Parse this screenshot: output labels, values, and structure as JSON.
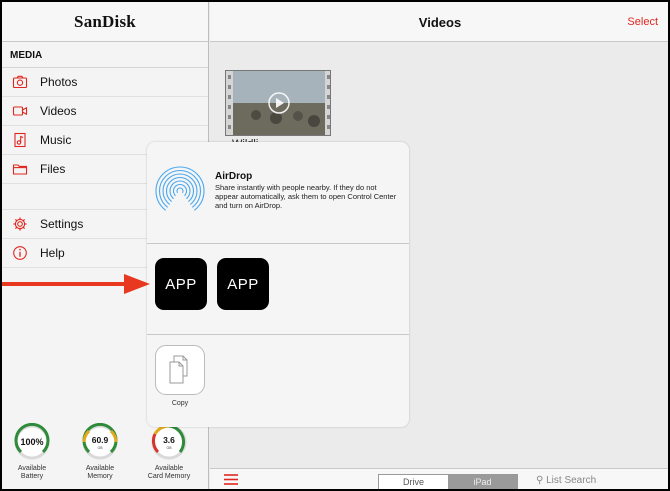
{
  "sidebar": {
    "logo": "SanDisk",
    "section_label": "MEDIA",
    "items": [
      {
        "label": "Photos"
      },
      {
        "label": "Videos"
      },
      {
        "label": "Music"
      },
      {
        "label": "Files"
      }
    ],
    "settings_label": "Settings",
    "help_label": "Help",
    "gauges": [
      {
        "value": "100%",
        "unit": "",
        "label_line1": "Available",
        "label_line2": "Battery",
        "color": "#2e8b3a"
      },
      {
        "value": "60.9",
        "unit": "GB",
        "label_line1": "Available",
        "label_line2": "Memory",
        "color": "#e3a91a"
      },
      {
        "value": "3.6",
        "unit": "GB",
        "label_line1": "Available",
        "label_line2": "Card Memory",
        "color": "#d5352a"
      }
    ]
  },
  "main": {
    "title": "Videos",
    "select_label": "Select",
    "thumbnail_caption": "Wildli...",
    "bottom_bar": {
      "segment_drive": "Drive",
      "segment_ipad": "iPad",
      "search_placeholder": "List Search"
    }
  },
  "share_sheet": {
    "airdrop_title": "AirDrop",
    "airdrop_description": "Share instantly with people nearby. If they do not appear automatically, ask them to open Control Center and turn on AirDrop.",
    "apps": [
      {
        "label": "APP"
      },
      {
        "label": "APP"
      }
    ],
    "copy_label": "Copy"
  },
  "colors": {
    "accent": "#e0271f",
    "arrow": "#e8381f"
  }
}
